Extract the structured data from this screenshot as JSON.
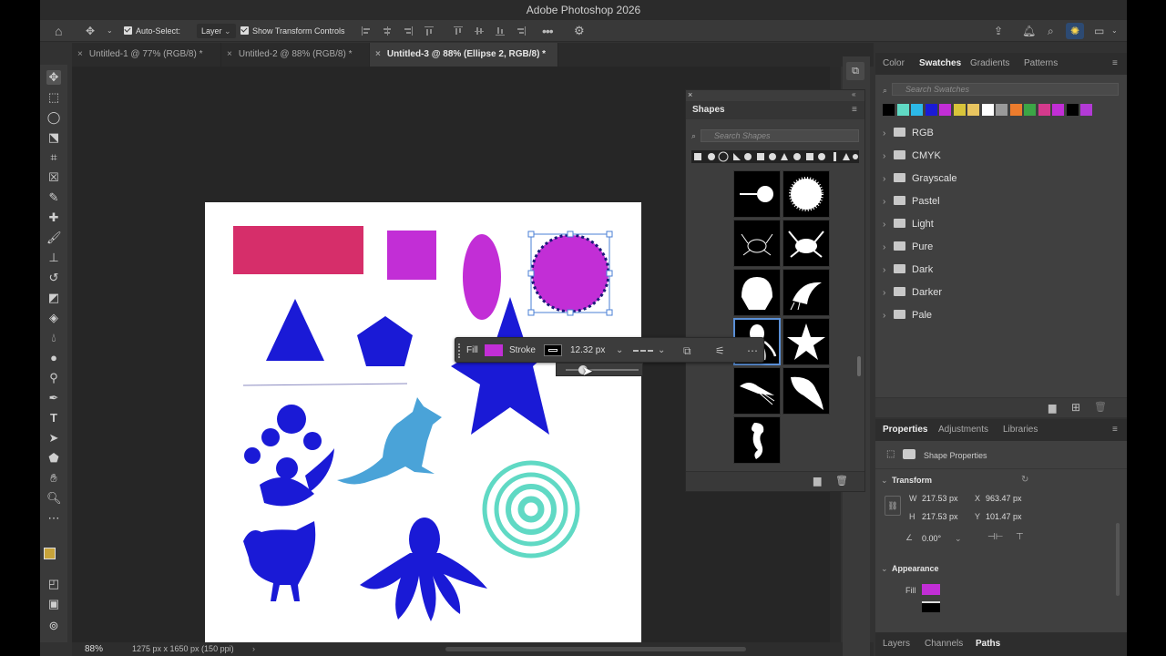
{
  "window": {
    "title": "Adobe Photoshop 2026"
  },
  "options_bar": {
    "auto_select_label": "Auto-Select:",
    "auto_select_value": "Layer",
    "transform_label": "Show Transform Controls"
  },
  "tabs": [
    {
      "label": "Untitled-1 @ 77% (RGB/8) *"
    },
    {
      "label": "Untitled-2 @ 88% (RGB/8) *"
    },
    {
      "label": "Untitled-3 @ 88% (Ellipse 2, RGB/8) *"
    }
  ],
  "status": {
    "zoom": "88%",
    "doc_info": "1275 px x 1650 px (150 ppi)"
  },
  "context_bar": {
    "fill_label": "Fill",
    "stroke_label": "Stroke",
    "stroke_width": "12.32 px"
  },
  "shapes_panel": {
    "title": "Shapes",
    "search_placeholder": "Search Shapes"
  },
  "top_panel": {
    "tabs": [
      {
        "label": "Color"
      },
      {
        "label": "Swatches"
      },
      {
        "label": "Gradients"
      },
      {
        "label": "Patterns"
      }
    ],
    "search_placeholder": "Search Swatches",
    "swatch_colors": [
      "#000000",
      "#60d9c4",
      "#2cb9e8",
      "#1a1ad6",
      "#c22ed6",
      "#d8c43a",
      "#e9c560",
      "#ffffff",
      "#9a9a9a",
      "#ec7c2d",
      "#3ca546",
      "#d43a8c",
      "#c22ed6",
      "#000000",
      "#b33ad6"
    ],
    "folders": [
      {
        "name": "RGB"
      },
      {
        "name": "CMYK"
      },
      {
        "name": "Grayscale"
      },
      {
        "name": "Pastel"
      },
      {
        "name": "Light"
      },
      {
        "name": "Pure"
      },
      {
        "name": "Dark"
      },
      {
        "name": "Darker"
      },
      {
        "name": "Pale"
      }
    ]
  },
  "properties": {
    "tabs": [
      {
        "label": "Properties"
      },
      {
        "label": "Adjustments"
      },
      {
        "label": "Libraries"
      }
    ],
    "subtitle": "Shape Properties",
    "transform_title": "Transform",
    "w_label": "W",
    "w": "217.53 px",
    "h_label": "H",
    "h": "217.53 px",
    "x_label": "X",
    "x": "963.47 px",
    "y_label": "Y",
    "y": "101.47 px",
    "angle": "0.00°",
    "appearance_title": "Appearance",
    "fill_label": "Fill",
    "fill_color": "#c22ed6"
  },
  "bottom_tabs": [
    {
      "label": "Layers"
    },
    {
      "label": "Channels"
    },
    {
      "label": "Paths"
    }
  ],
  "colors": {
    "shape_blue": "#1a1ad6",
    "magenta": "#c22ed6",
    "pink": "#d62e6a",
    "kangaroo": "#4aa3d8",
    "teal": "#60d9c4"
  }
}
